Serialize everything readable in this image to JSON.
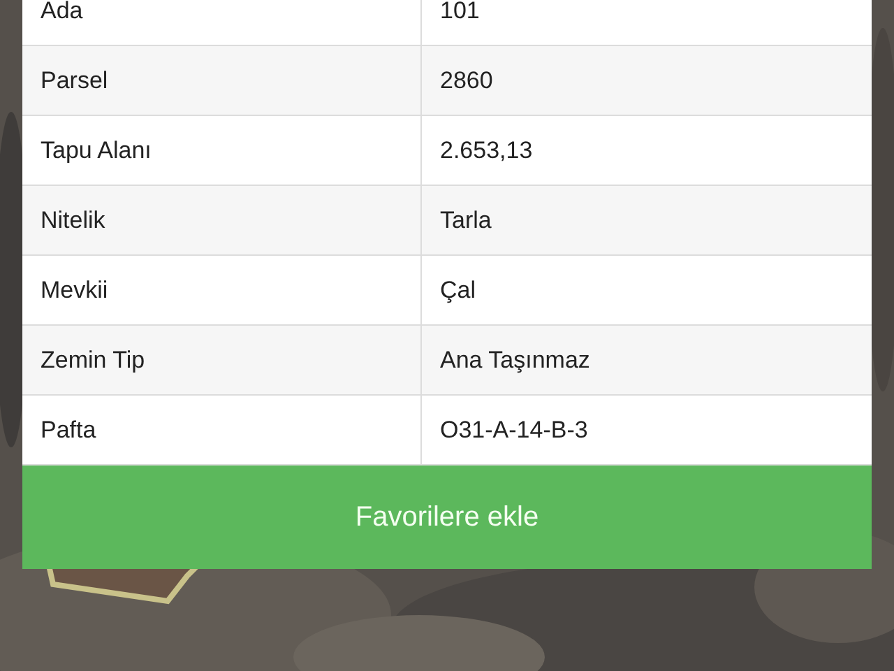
{
  "parcel_info": [
    {
      "label": "Ada",
      "value": "101"
    },
    {
      "label": "Parsel",
      "value": "2860"
    },
    {
      "label": "Tapu Alanı",
      "value": "2.653,13"
    },
    {
      "label": "Nitelik",
      "value": "Tarla"
    },
    {
      "label": "Mevkii",
      "value": "Çal"
    },
    {
      "label": "Zemin Tip",
      "value": "Ana Taşınmaz"
    },
    {
      "label": "Pafta",
      "value": "O31-A-14-B-3"
    }
  ],
  "add_favorite_button": "Favorilere ekle"
}
